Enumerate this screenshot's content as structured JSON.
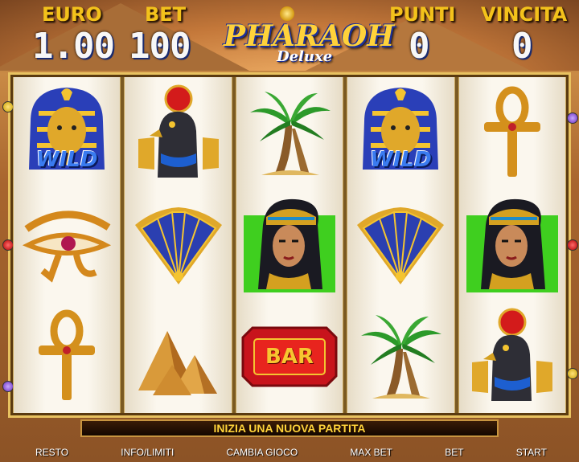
{
  "header": {
    "euro_label": "EURO",
    "euro_value": "1.00",
    "bet_label": "BET",
    "bet_value": "100",
    "points_label": "PUNTI",
    "points_value": "0",
    "win_label": "VINCITA",
    "win_value": "0",
    "logo_title": "PHARAOH",
    "logo_subtitle": "Deluxe"
  },
  "reels": [
    [
      "pharaoh-wild",
      "eye-of-horus",
      "ankh"
    ],
    [
      "horus-falcon",
      "lotus-fan",
      "pyramids"
    ],
    [
      "palm-tree",
      "cleopatra",
      "bar"
    ],
    [
      "pharaoh-wild",
      "lotus-fan",
      "palm-tree"
    ],
    [
      "ankh",
      "cleopatra",
      "horus-falcon"
    ]
  ],
  "symbols": {
    "wild_text": "WILD",
    "bar_text": "BAR"
  },
  "message": "INIZIA UNA NUOVA PARTITA",
  "buttons": {
    "resto": "RESTO",
    "info": "INFO/LIMITI",
    "change": "CAMBIA GIOCO",
    "maxbet": "MAX BET",
    "bet": "BET",
    "start": "START"
  },
  "colors": {
    "label_gold": "#f3c21b",
    "message_yellow": "#ffd33a",
    "frame_gold": "#e8c260"
  }
}
